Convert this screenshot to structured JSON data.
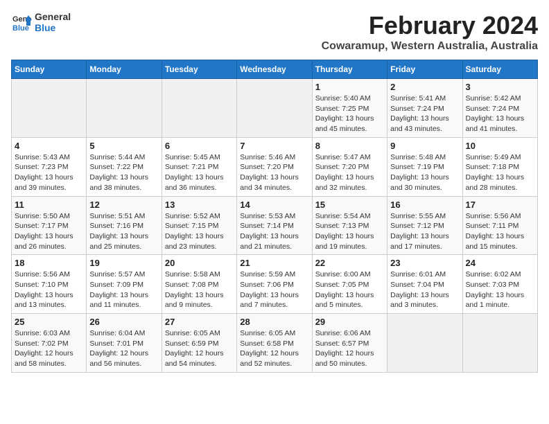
{
  "logo": {
    "line1": "General",
    "line2": "Blue"
  },
  "title": "February 2024",
  "location": "Cowaramup, Western Australia, Australia",
  "weekdays": [
    "Sunday",
    "Monday",
    "Tuesday",
    "Wednesday",
    "Thursday",
    "Friday",
    "Saturday"
  ],
  "weeks": [
    [
      {
        "day": "",
        "detail": ""
      },
      {
        "day": "",
        "detail": ""
      },
      {
        "day": "",
        "detail": ""
      },
      {
        "day": "",
        "detail": ""
      },
      {
        "day": "1",
        "detail": "Sunrise: 5:40 AM\nSunset: 7:25 PM\nDaylight: 13 hours\nand 45 minutes."
      },
      {
        "day": "2",
        "detail": "Sunrise: 5:41 AM\nSunset: 7:24 PM\nDaylight: 13 hours\nand 43 minutes."
      },
      {
        "day": "3",
        "detail": "Sunrise: 5:42 AM\nSunset: 7:24 PM\nDaylight: 13 hours\nand 41 minutes."
      }
    ],
    [
      {
        "day": "4",
        "detail": "Sunrise: 5:43 AM\nSunset: 7:23 PM\nDaylight: 13 hours\nand 39 minutes."
      },
      {
        "day": "5",
        "detail": "Sunrise: 5:44 AM\nSunset: 7:22 PM\nDaylight: 13 hours\nand 38 minutes."
      },
      {
        "day": "6",
        "detail": "Sunrise: 5:45 AM\nSunset: 7:21 PM\nDaylight: 13 hours\nand 36 minutes."
      },
      {
        "day": "7",
        "detail": "Sunrise: 5:46 AM\nSunset: 7:20 PM\nDaylight: 13 hours\nand 34 minutes."
      },
      {
        "day": "8",
        "detail": "Sunrise: 5:47 AM\nSunset: 7:20 PM\nDaylight: 13 hours\nand 32 minutes."
      },
      {
        "day": "9",
        "detail": "Sunrise: 5:48 AM\nSunset: 7:19 PM\nDaylight: 13 hours\nand 30 minutes."
      },
      {
        "day": "10",
        "detail": "Sunrise: 5:49 AM\nSunset: 7:18 PM\nDaylight: 13 hours\nand 28 minutes."
      }
    ],
    [
      {
        "day": "11",
        "detail": "Sunrise: 5:50 AM\nSunset: 7:17 PM\nDaylight: 13 hours\nand 26 minutes."
      },
      {
        "day": "12",
        "detail": "Sunrise: 5:51 AM\nSunset: 7:16 PM\nDaylight: 13 hours\nand 25 minutes."
      },
      {
        "day": "13",
        "detail": "Sunrise: 5:52 AM\nSunset: 7:15 PM\nDaylight: 13 hours\nand 23 minutes."
      },
      {
        "day": "14",
        "detail": "Sunrise: 5:53 AM\nSunset: 7:14 PM\nDaylight: 13 hours\nand 21 minutes."
      },
      {
        "day": "15",
        "detail": "Sunrise: 5:54 AM\nSunset: 7:13 PM\nDaylight: 13 hours\nand 19 minutes."
      },
      {
        "day": "16",
        "detail": "Sunrise: 5:55 AM\nSunset: 7:12 PM\nDaylight: 13 hours\nand 17 minutes."
      },
      {
        "day": "17",
        "detail": "Sunrise: 5:56 AM\nSunset: 7:11 PM\nDaylight: 13 hours\nand 15 minutes."
      }
    ],
    [
      {
        "day": "18",
        "detail": "Sunrise: 5:56 AM\nSunset: 7:10 PM\nDaylight: 13 hours\nand 13 minutes."
      },
      {
        "day": "19",
        "detail": "Sunrise: 5:57 AM\nSunset: 7:09 PM\nDaylight: 13 hours\nand 11 minutes."
      },
      {
        "day": "20",
        "detail": "Sunrise: 5:58 AM\nSunset: 7:08 PM\nDaylight: 13 hours\nand 9 minutes."
      },
      {
        "day": "21",
        "detail": "Sunrise: 5:59 AM\nSunset: 7:06 PM\nDaylight: 13 hours\nand 7 minutes."
      },
      {
        "day": "22",
        "detail": "Sunrise: 6:00 AM\nSunset: 7:05 PM\nDaylight: 13 hours\nand 5 minutes."
      },
      {
        "day": "23",
        "detail": "Sunrise: 6:01 AM\nSunset: 7:04 PM\nDaylight: 13 hours\nand 3 minutes."
      },
      {
        "day": "24",
        "detail": "Sunrise: 6:02 AM\nSunset: 7:03 PM\nDaylight: 13 hours\nand 1 minute."
      }
    ],
    [
      {
        "day": "25",
        "detail": "Sunrise: 6:03 AM\nSunset: 7:02 PM\nDaylight: 12 hours\nand 58 minutes."
      },
      {
        "day": "26",
        "detail": "Sunrise: 6:04 AM\nSunset: 7:01 PM\nDaylight: 12 hours\nand 56 minutes."
      },
      {
        "day": "27",
        "detail": "Sunrise: 6:05 AM\nSunset: 6:59 PM\nDaylight: 12 hours\nand 54 minutes."
      },
      {
        "day": "28",
        "detail": "Sunrise: 6:05 AM\nSunset: 6:58 PM\nDaylight: 12 hours\nand 52 minutes."
      },
      {
        "day": "29",
        "detail": "Sunrise: 6:06 AM\nSunset: 6:57 PM\nDaylight: 12 hours\nand 50 minutes."
      },
      {
        "day": "",
        "detail": ""
      },
      {
        "day": "",
        "detail": ""
      }
    ]
  ]
}
